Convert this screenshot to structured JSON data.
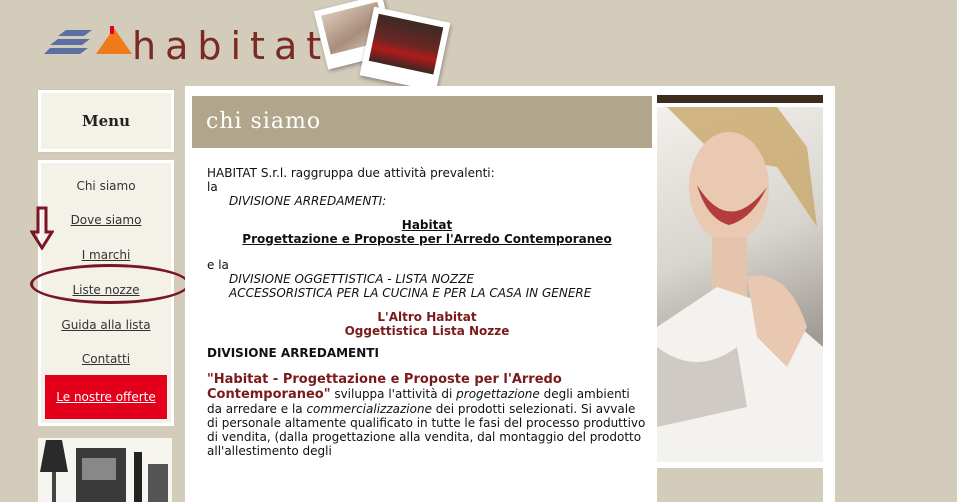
{
  "brand": {
    "name": "habitat"
  },
  "menu": {
    "title": "Menu",
    "items": [
      {
        "label": "Chi siamo"
      },
      {
        "label": "Dove siamo"
      },
      {
        "label": "I marchi"
      },
      {
        "label": "Liste nozze"
      },
      {
        "label": "Guida alla lista"
      },
      {
        "label": "Contatti"
      }
    ],
    "offer_label": "Le nostre offerte"
  },
  "page": {
    "title": "chi siamo",
    "intro": "HABITAT S.r.l. raggruppa due attività prevalenti:",
    "la1": "la",
    "div1": "DIVISIONE ARREDAMENTI:",
    "habitat_title": "Habitat",
    "habitat_sub": "Progettazione e Proposte per l'Arredo Contemporaneo",
    "la2": "e la",
    "div2_line1": "DIVISIONE OGGETTISTICA - LISTA NOZZE",
    "div2_line2": "ACCESSORISTICA PER LA CUCINA E PER LA CASA IN GENERE",
    "altro_title": "L'Altro Habitat",
    "altro_sub": "Oggettistica Lista Nozze",
    "section_heading": "DIVISIONE ARREDAMENTI",
    "para_quote": "\"Habitat - Progettazione e Proposte per l'Arredo Contemporaneo\"",
    "para_1": " sviluppa l'attività di ",
    "para_em1": "progettazione",
    "para_2": " degli ambienti da arredare e la ",
    "para_em2": "commercializzazione",
    "para_3": " dei prodotti selezionati. Si avvale di personale altamente qualificato in tutte le fasi del processo produttivo di vendita, (dalla progettazione alla vendita, dal montaggio del prodotto all'allestimento degli"
  },
  "colors": {
    "accent": "#e2001a",
    "header": "#b1a68c",
    "brand": "#7a2a22"
  }
}
